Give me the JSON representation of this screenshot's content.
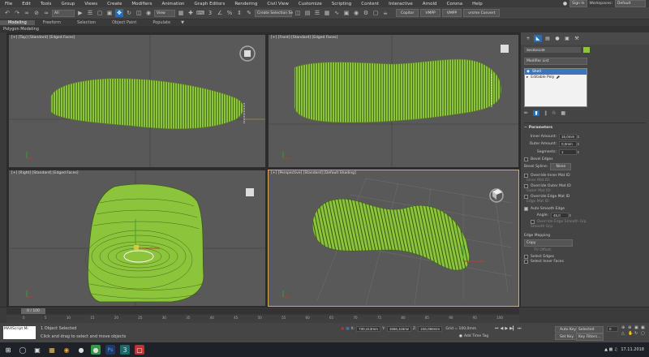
{
  "menu": [
    "File",
    "Edit",
    "Tools",
    "Group",
    "Views",
    "Create",
    "Modifiers",
    "Animation",
    "Graph Editors",
    "Rendering",
    "Civil View",
    "Customize",
    "Scripting",
    "Content",
    "Interactive",
    "Arnold",
    "Corona",
    "Help"
  ],
  "account": {
    "sign_in": "Sign In",
    "workspaces_label": "Workspaces:",
    "workspace": "Default"
  },
  "toolbar": {
    "filter": "All",
    "ref_coord": "View",
    "selection_set": "Create Selection Se",
    "copitor": "Copitor",
    "vmpp": "VMPP",
    "vmpp2": "VMPP",
    "convert": "vrsme Convert"
  },
  "ribbon": {
    "tabs": [
      "Modeling",
      "Freeform",
      "Selection",
      "Object Paint",
      "Populate"
    ],
    "active": "Modeling",
    "sub": "Polygon Modeling"
  },
  "viewports": {
    "top": "[+] [Top] [Standard] [Edged Faces]",
    "front": "[+] [Front] [Standard] [Edged Faces]",
    "right": "[+] [Right] [Standard] [Edged Faces]",
    "persp": "[+] [Perspective] [Standard] [Default Shading]"
  },
  "command_panel": {
    "object_name": "Section149",
    "modifier_list": "Modifier List",
    "stack": [
      "Shell",
      "Editable Poly"
    ],
    "rollout_title": "Parameters",
    "inner_amount_label": "Inner Amount:",
    "inner_amount": "15,0mm",
    "outer_amount_label": "Outer Amount:",
    "outer_amount": "0,0mm",
    "segments_label": "Segments:",
    "segments": "1",
    "bevel_edges": "Bevel Edges",
    "bevel_spline_label": "Bevel Spline:",
    "bevel_spline": "None",
    "override_inner": "Override Inner Mat ID",
    "inner_mat_id": "Inner Mat ID:",
    "override_outer": "Override Outer Mat ID",
    "outer_mat_id": "Outer Mat ID:",
    "override_edge": "Override Edge Mat ID",
    "edge_mat_id": "Edge Mat ID:",
    "auto_smooth": "Auto Smooth Edge",
    "angle_label": "Angle:",
    "angle": "45,0",
    "override_edge_smooth": "Override Edge Smooth Grp",
    "smooth_grp": "Smooth Grp:",
    "edge_mapping": "Edge Mapping",
    "copy": "Copy",
    "tv_offset": "TV Offset:",
    "select_edges": "Select Edges",
    "select_inner_faces": "Select Inner Faces"
  },
  "timeline": {
    "frame_counter": "0 / 100",
    "ticks": [
      "0",
      "5",
      "10",
      "15",
      "20",
      "25",
      "30",
      "35",
      "40",
      "45",
      "50",
      "55",
      "60",
      "65",
      "70",
      "75",
      "80",
      "85",
      "90",
      "95",
      "100"
    ]
  },
  "status": {
    "script_label": "MAXScript Mi",
    "selected": "1 Object Selected",
    "prompt": "Click and drag to select and move objects",
    "x_label": "X:",
    "x": "730,413mm",
    "y_label": "Y:",
    "y": "1566,116mm",
    "z_label": "Z:",
    "z": "246,058mm",
    "grid": "Grid = 100,0mm",
    "add_time_tag": "Add Time Tag",
    "auto_key": "Auto Key",
    "auto_key_sel": "Selected",
    "set_key": "Set Key",
    "key_filters": "Key Filters...",
    "frame": "0"
  },
  "taskbar": {
    "date": "17.11.2018"
  },
  "colors": {
    "model_green": "#8cc43c",
    "viewport_bg": "#595959",
    "active_border": "#d7b24a",
    "select_blue": "#2a6cb0"
  }
}
